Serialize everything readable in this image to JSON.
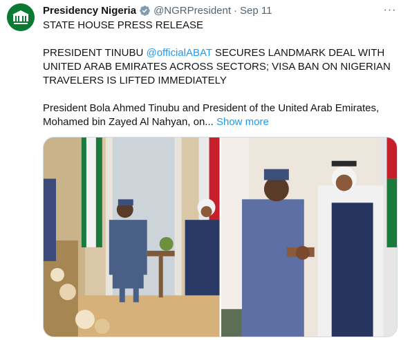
{
  "account": {
    "display_name": "Presidency Nigeria",
    "handle": "@NGRPresident",
    "separator": "·",
    "date": "Sep 11",
    "avatar_icon": "state-house-logo-icon",
    "verified_icon": "verified-badge-icon",
    "verified_color": "#829aab"
  },
  "tweet": {
    "line1": "STATE HOUSE PRESS RELEASE",
    "headline_prefix": "PRESIDENT TINUBU ",
    "mention": "@officialABAT",
    "headline_suffix": " SECURES LANDMARK DEAL WITH UNITED ARAB EMIRATES ACROSS SECTORS; VISA BAN ON NIGERIAN TRAVELERS IS LIFTED IMMEDIATELY",
    "body": "President Bola Ahmed Tinubu and President of the United Arab Emirates, Mohamed bin Zayed Al Nahyan, on... ",
    "show_more": "Show more",
    "more_icon": "···"
  },
  "media": {
    "photos": [
      "meeting-photo",
      "handshake-photo"
    ]
  },
  "colors": {
    "link": "#1d9bf0",
    "secondary_text": "#536471",
    "border": "#cfd9de"
  }
}
